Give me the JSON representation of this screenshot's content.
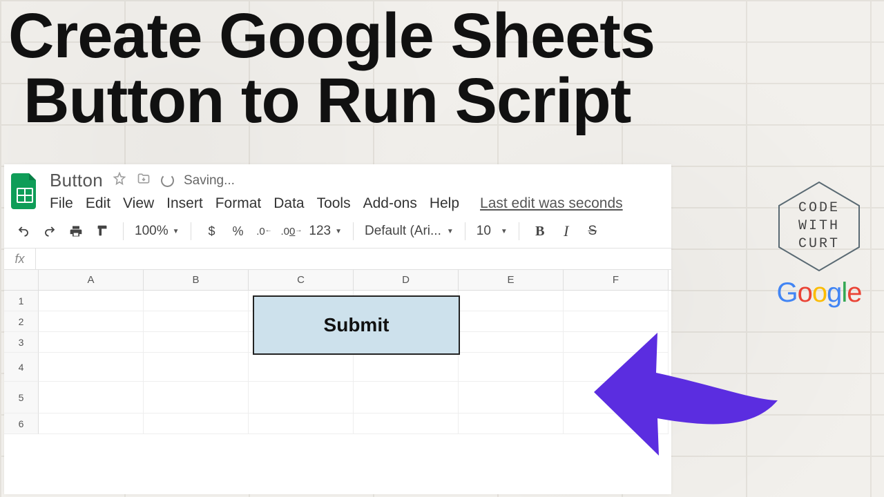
{
  "title_line1": "Create Google Sheets",
  "title_line2": "Button to Run Script",
  "doc": {
    "name": "Button",
    "status": "Saving...",
    "last_edit": "Last edit was seconds"
  },
  "menubar": [
    "File",
    "Edit",
    "View",
    "Insert",
    "Format",
    "Data",
    "Tools",
    "Add-ons",
    "Help"
  ],
  "toolbar": {
    "zoom": "100%",
    "currency": "$",
    "percent": "%",
    "dec_dec": ".0",
    "inc_dec": ".00",
    "more_fmt": "123",
    "font": "Default (Ari...",
    "size": "10",
    "bold": "B",
    "italic": "I",
    "strike": "S"
  },
  "fx_label": "fx",
  "columns": [
    "A",
    "B",
    "C",
    "D",
    "E",
    "F"
  ],
  "rows": [
    "1",
    "2",
    "3",
    "4",
    "5",
    "6"
  ],
  "submit_label": "Submit",
  "badge": {
    "line1": "CODE",
    "line2": "WITH",
    "line3": "CURT"
  },
  "google": [
    "G",
    "o",
    "o",
    "g",
    "l",
    "e"
  ]
}
